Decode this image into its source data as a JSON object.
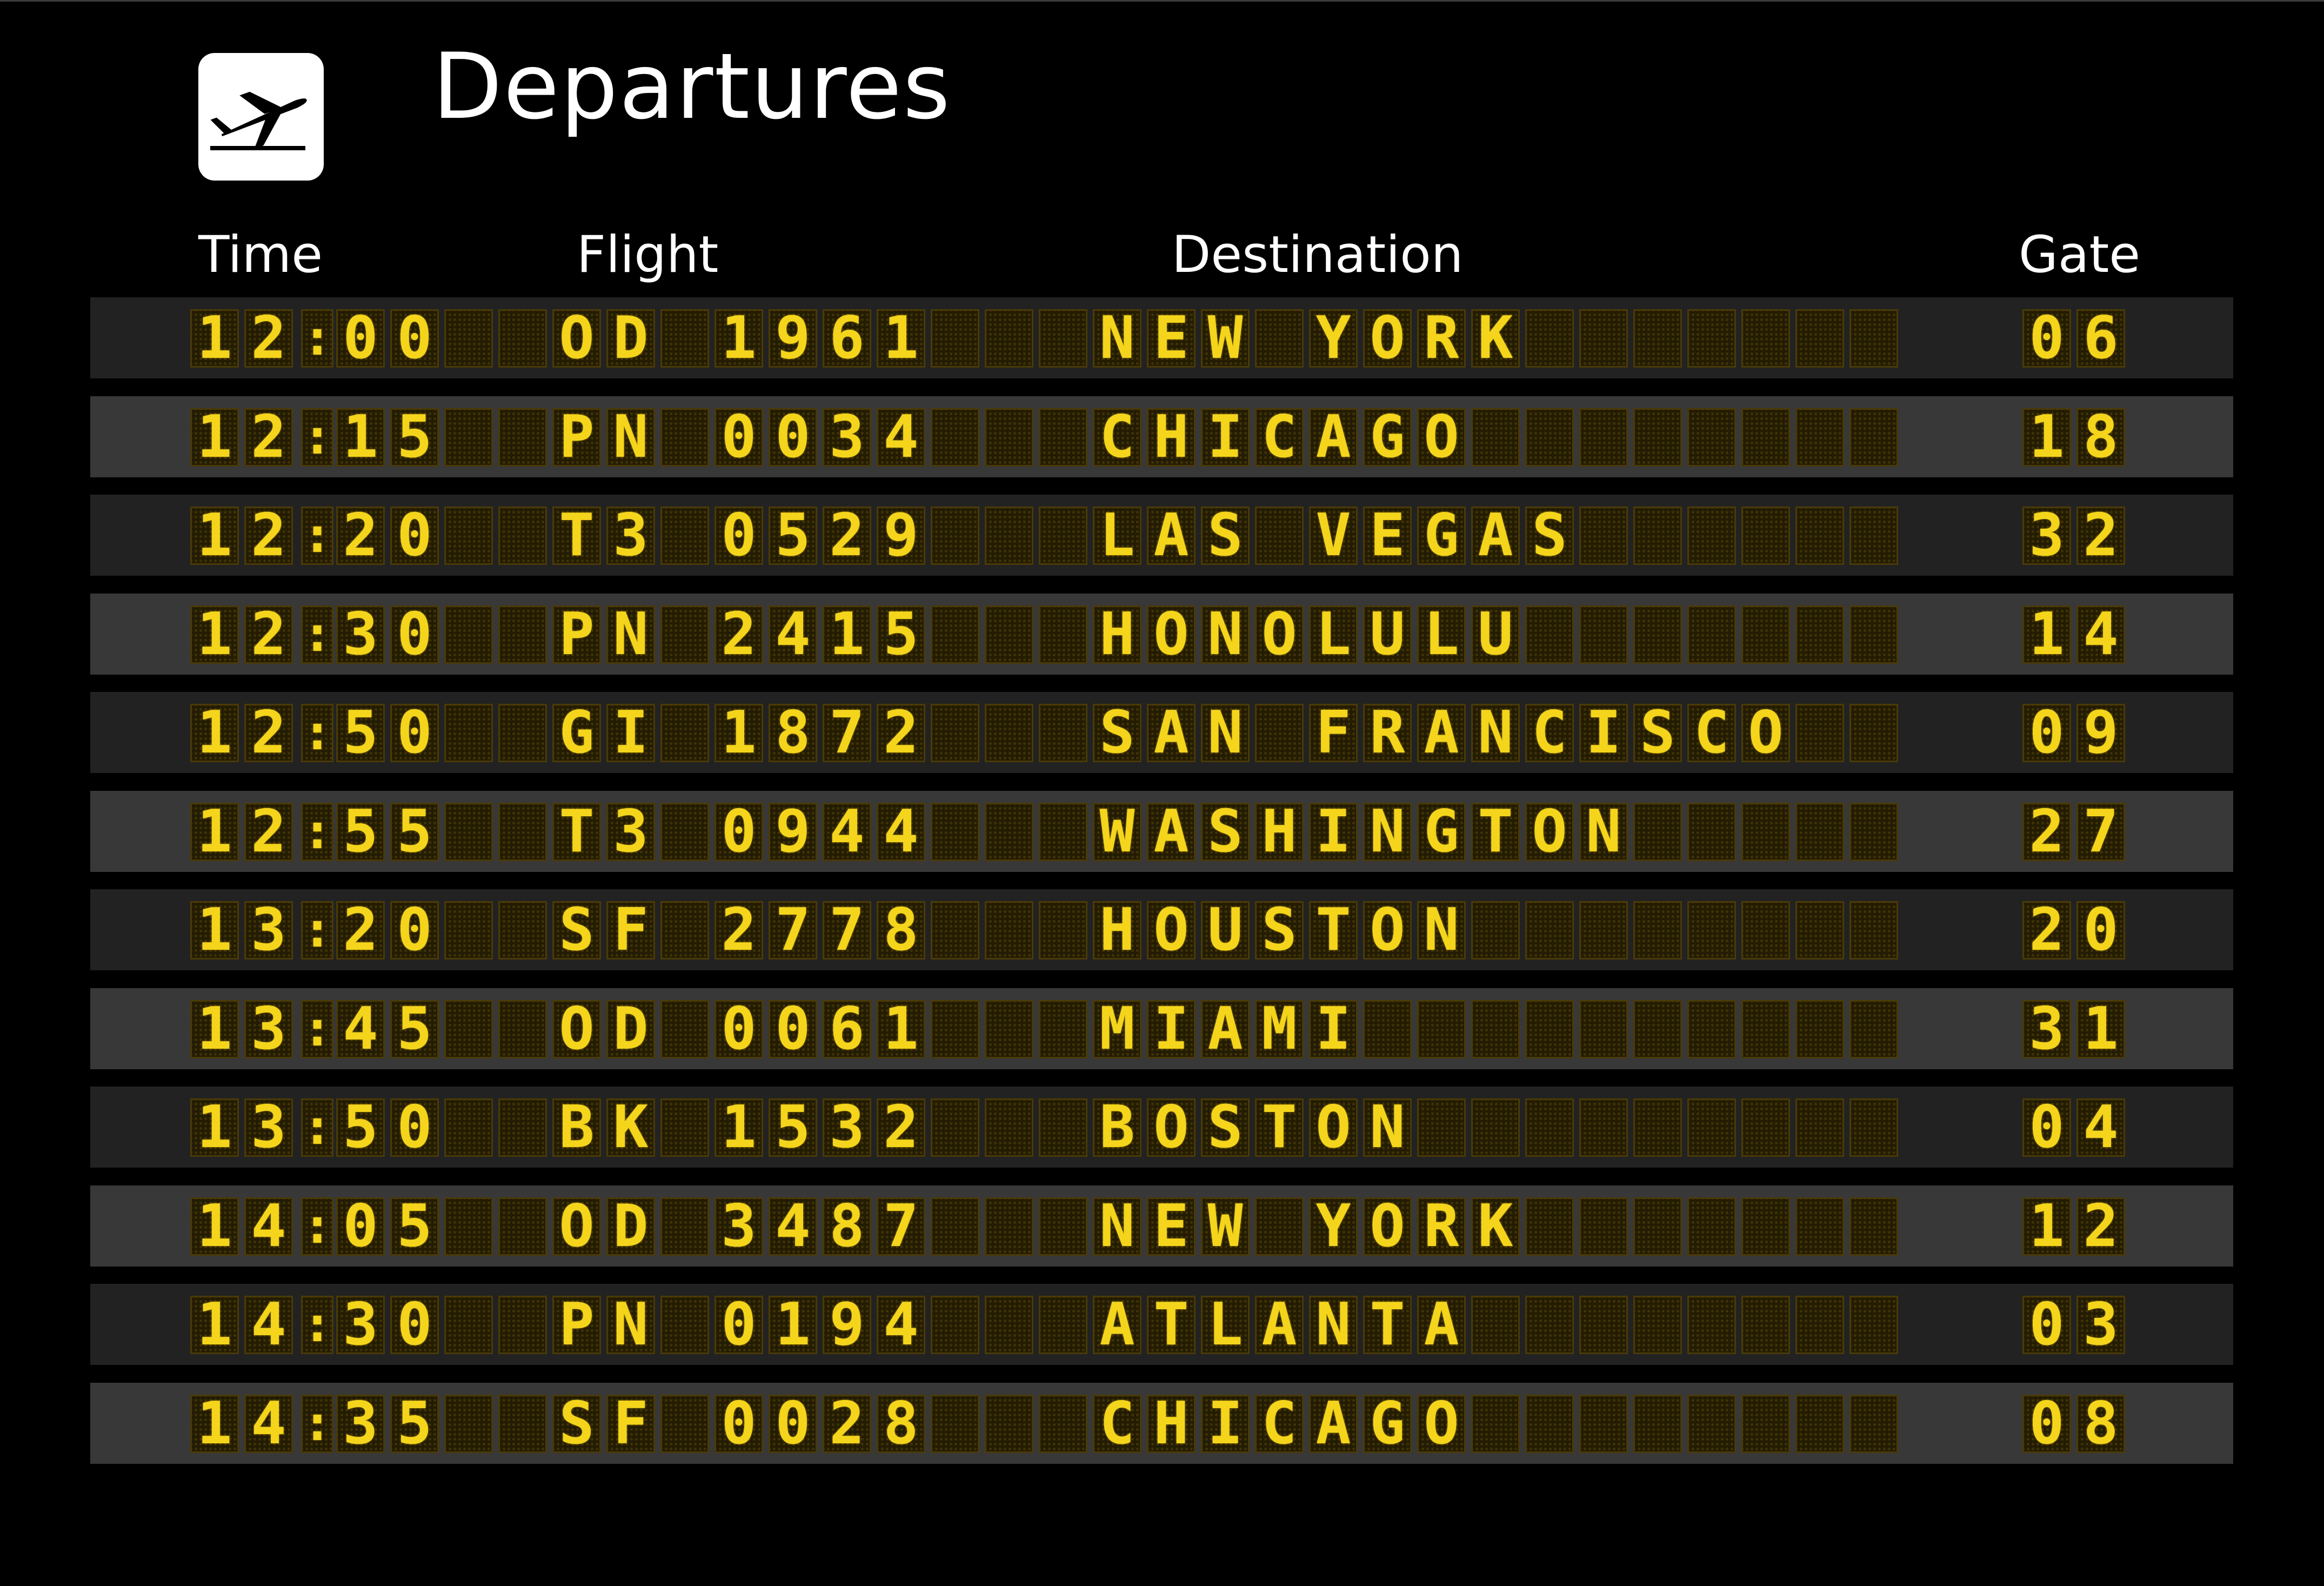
{
  "board": {
    "title": "Departures",
    "icon": "airplane-departure-icon",
    "colors": {
      "background": "#000000",
      "row_dark": "#222222",
      "row_light": "#383838",
      "digit": "#f4d51c",
      "cell_bg": "#231c02"
    },
    "columns": {
      "time": "Time",
      "flight": "Flight",
      "destination": "Destination",
      "gate": "Gate"
    },
    "rows": [
      {
        "time": "12:00",
        "airline": "OD",
        "number": "1961",
        "destination": "NEW YORK",
        "gate": "06"
      },
      {
        "time": "12:15",
        "airline": "PN",
        "number": "0034",
        "destination": "CHICAGO",
        "gate": "18"
      },
      {
        "time": "12:20",
        "airline": "T3",
        "number": "0529",
        "destination": "LAS VEGAS",
        "gate": "32"
      },
      {
        "time": "12:30",
        "airline": "PN",
        "number": "2415",
        "destination": "HONOLULU",
        "gate": "14"
      },
      {
        "time": "12:50",
        "airline": "GI",
        "number": "1872",
        "destination": "SAN FRANCISCO",
        "gate": "09"
      },
      {
        "time": "12:55",
        "airline": "T3",
        "number": "0944",
        "destination": "WASHINGTON",
        "gate": "27"
      },
      {
        "time": "13:20",
        "airline": "SF",
        "number": "2778",
        "destination": "HOUSTON",
        "gate": "20"
      },
      {
        "time": "13:45",
        "airline": "OD",
        "number": "0061",
        "destination": "MIAMI",
        "gate": "31"
      },
      {
        "time": "13:50",
        "airline": "BK",
        "number": "1532",
        "destination": "BOSTON",
        "gate": "04"
      },
      {
        "time": "14:05",
        "airline": "OD",
        "number": "3487",
        "destination": "NEW YORK",
        "gate": "12"
      },
      {
        "time": "14:30",
        "airline": "PN",
        "number": "0194",
        "destination": "ATLANTA",
        "gate": "03"
      },
      {
        "time": "14:35",
        "airline": "SF",
        "number": "0028",
        "destination": "CHICAGO",
        "gate": "08"
      }
    ]
  }
}
